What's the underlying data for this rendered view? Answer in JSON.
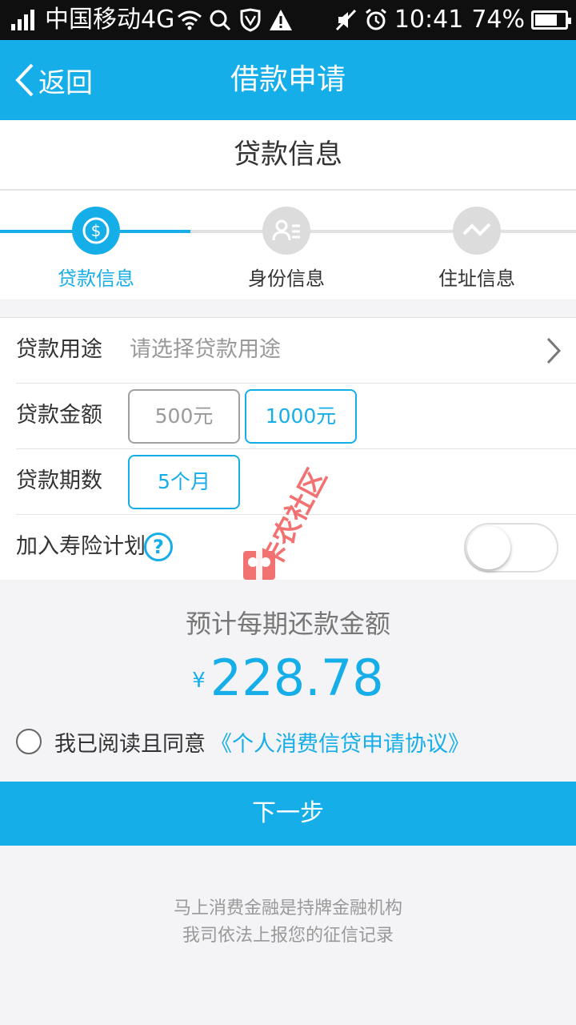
{
  "status_bar": {
    "carrier": "中国移动4G",
    "time": "10:41",
    "battery_percent": "74%",
    "battery_level": 0.74,
    "icons": [
      "signal-icon",
      "wifi-icon",
      "search-icon",
      "shield-icon",
      "warning-icon",
      "mute-icon",
      "alarm-icon",
      "battery-icon"
    ]
  },
  "header": {
    "back_label": "返回",
    "title": "借款申请"
  },
  "section_title": "贷款信息",
  "steps": [
    {
      "label": "贷款信息",
      "icon": "dollar-icon",
      "active": true
    },
    {
      "label": "身份信息",
      "icon": "id-card-icon",
      "active": false
    },
    {
      "label": "住址信息",
      "icon": "wave-icon",
      "active": false
    }
  ],
  "form": {
    "purpose": {
      "label": "贷款用途",
      "placeholder": "请选择贷款用途"
    },
    "amount": {
      "label": "贷款金额",
      "options": [
        "500元",
        "1000元"
      ],
      "selected": "1000元"
    },
    "term": {
      "label": "贷款期数",
      "options": [
        "5个月"
      ],
      "selected": "5个月"
    },
    "insurance": {
      "label": "加入寿险计划",
      "help": "?",
      "enabled": false
    }
  },
  "estimate": {
    "label": "预计每期还款金额",
    "currency": "¥",
    "value": "228.78"
  },
  "agreement": {
    "text": "我已阅读且同意",
    "link": "《个人消费信贷申请协议》",
    "checked": false
  },
  "next_button": "下一步",
  "footer": {
    "line1": "马上消费金融是持牌金融机构",
    "line2": "我司依法上报您的征信记录"
  },
  "watermark": {
    "text": "卡农社区"
  },
  "colors": {
    "accent": "#15aee9",
    "status_bar": "#0f0f10",
    "background": "#f4f4f6"
  }
}
